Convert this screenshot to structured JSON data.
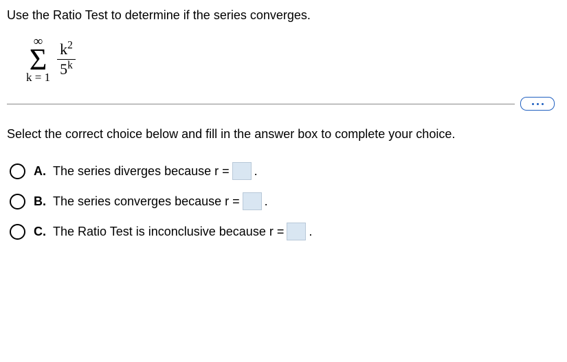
{
  "question": "Use the Ratio Test to determine if the series converges.",
  "series": {
    "sigma_top": "∞",
    "sigma_symbol": "Σ",
    "sigma_bottom": "k = 1",
    "numerator_base": "k",
    "numerator_exp": "2",
    "denominator_base": "5",
    "denominator_exp": "k"
  },
  "instruction": "Select the correct choice below and fill in the answer box to complete your choice.",
  "choices": [
    {
      "letter": "A.",
      "pre": "The series diverges because r =",
      "post": "."
    },
    {
      "letter": "B.",
      "pre": "The series converges because r =",
      "post": "."
    },
    {
      "letter": "C.",
      "pre": "The Ratio Test is inconclusive because r =",
      "post": "."
    }
  ]
}
